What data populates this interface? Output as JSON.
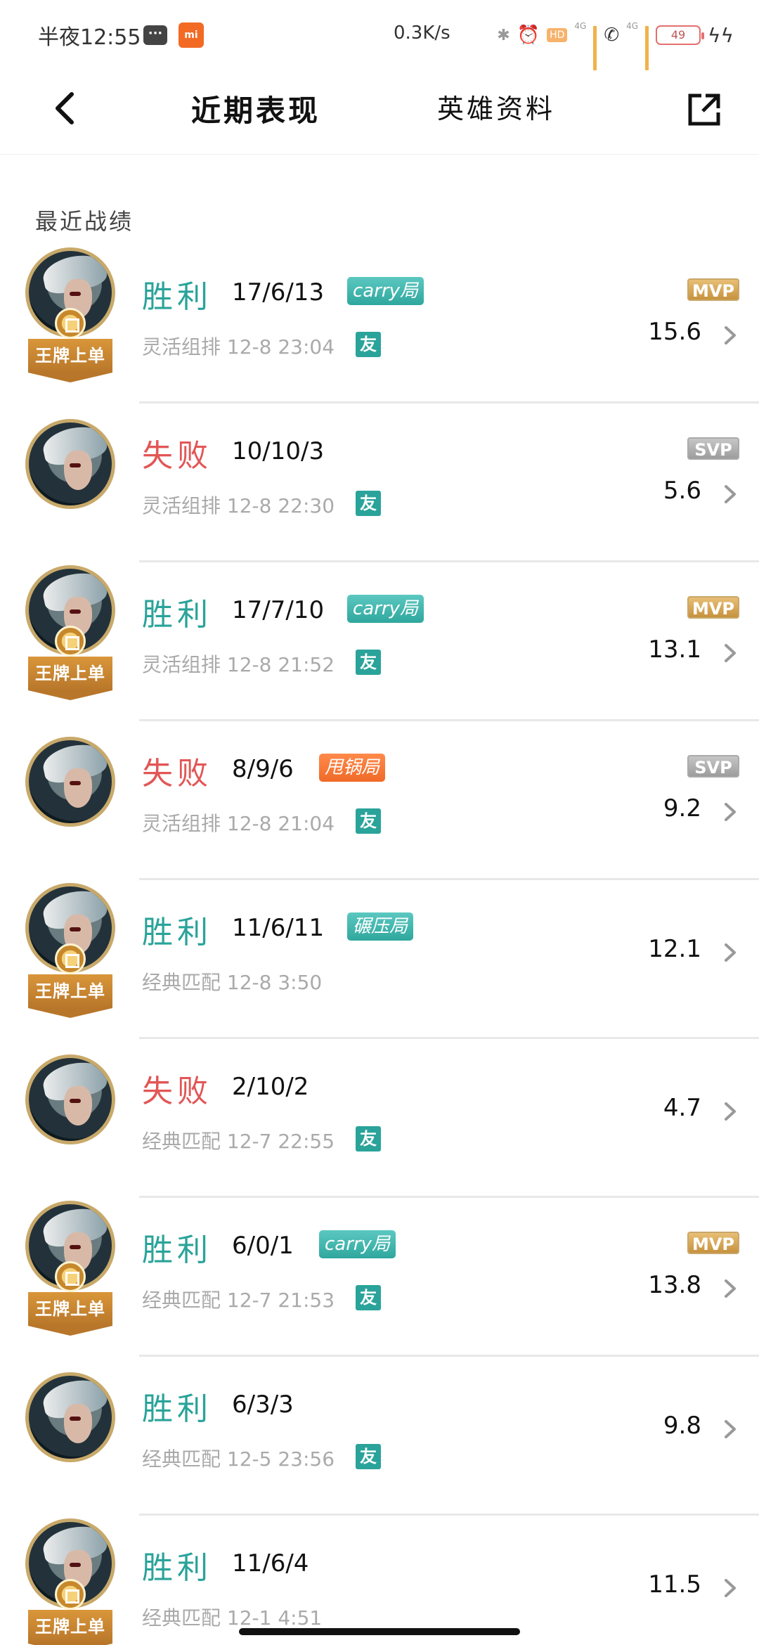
{
  "status_bar": {
    "time": "半夜12:55",
    "net_speed": "0.3K/s",
    "hd": "HD",
    "network_1": "4G",
    "network_2": "4G",
    "battery": "49",
    "icons": [
      "message-icon",
      "mi-icon",
      "bluetooth-icon",
      "alarm-icon",
      "signal-icon",
      "call-icon",
      "battery-icon",
      "charging-icon"
    ]
  },
  "header": {
    "tab_recent": "近期表现",
    "tab_hero": "英雄资料"
  },
  "section_title": "最近战绩",
  "badge_label": "王牌上单",
  "colors": {
    "win": "#2aa39a",
    "loss": "#e25656",
    "mvp": "#c58f3a",
    "svp": "#9a9a9a",
    "tag_teal": "#2fa79e",
    "tag_orange": "#f06a28"
  },
  "matches": [
    {
      "result": "胜利",
      "outcome": "win",
      "kda": "17/6/13",
      "tag": "carry局",
      "tag_style": "teal",
      "mode": "灵活组排",
      "time": "12-8 23:04",
      "friend": "友",
      "award": "MVP",
      "score": "15.6",
      "badge": true
    },
    {
      "result": "失败",
      "outcome": "loss",
      "kda": "10/10/3",
      "tag": "",
      "tag_style": "",
      "mode": "灵活组排",
      "time": "12-8 22:30",
      "friend": "友",
      "award": "SVP",
      "score": "5.6",
      "badge": false
    },
    {
      "result": "胜利",
      "outcome": "win",
      "kda": "17/7/10",
      "tag": "carry局",
      "tag_style": "teal",
      "mode": "灵活组排",
      "time": "12-8 21:52",
      "friend": "友",
      "award": "MVP",
      "score": "13.1",
      "badge": true
    },
    {
      "result": "失败",
      "outcome": "loss",
      "kda": "8/9/6",
      "tag": "甩锅局",
      "tag_style": "orange",
      "mode": "灵活组排",
      "time": "12-8 21:04",
      "friend": "友",
      "award": "SVP",
      "score": "9.2",
      "badge": false
    },
    {
      "result": "胜利",
      "outcome": "win",
      "kda": "11/6/11",
      "tag": "碾压局",
      "tag_style": "teal",
      "mode": "经典匹配",
      "time": "12-8 3:50",
      "friend": "",
      "award": "",
      "score": "12.1",
      "badge": true
    },
    {
      "result": "失败",
      "outcome": "loss",
      "kda": "2/10/2",
      "tag": "",
      "tag_style": "",
      "mode": "经典匹配",
      "time": "12-7 22:55",
      "friend": "友",
      "award": "",
      "score": "4.7",
      "badge": false
    },
    {
      "result": "胜利",
      "outcome": "win",
      "kda": "6/0/1",
      "tag": "carry局",
      "tag_style": "teal",
      "mode": "经典匹配",
      "time": "12-7 21:53",
      "friend": "友",
      "award": "MVP",
      "score": "13.8",
      "badge": true
    },
    {
      "result": "胜利",
      "outcome": "win",
      "kda": "6/3/3",
      "tag": "",
      "tag_style": "",
      "mode": "经典匹配",
      "time": "12-5 23:56",
      "friend": "友",
      "award": "",
      "score": "9.8",
      "badge": false
    },
    {
      "result": "胜利",
      "outcome": "win",
      "kda": "11/6/4",
      "tag": "",
      "tag_style": "",
      "mode": "经典匹配",
      "time": "12-1 4:51",
      "friend": "",
      "award": "",
      "score": "11.5",
      "badge": true
    }
  ]
}
